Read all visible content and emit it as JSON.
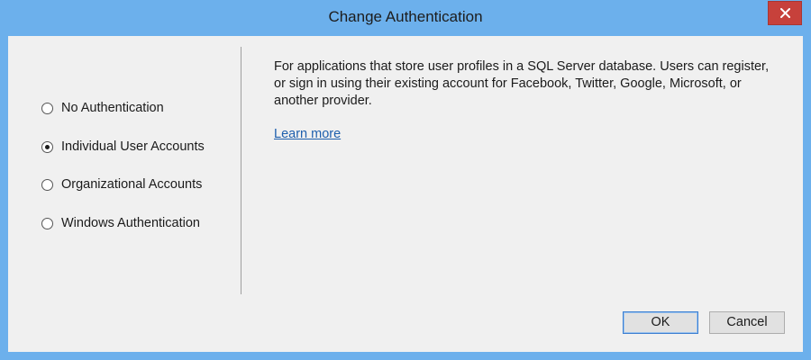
{
  "window": {
    "title": "Change Authentication"
  },
  "auth_options": [
    {
      "label": "No Authentication",
      "checked": false
    },
    {
      "label": "Individual User Accounts",
      "checked": true
    },
    {
      "label": "Organizational Accounts",
      "checked": false
    },
    {
      "label": "Windows Authentication",
      "checked": false
    }
  ],
  "description": {
    "text": "For applications that store user profiles in a SQL Server database. Users can register, or sign in using their existing account for Facebook, Twitter, Google, Microsoft, or another provider.",
    "learn_more": "Learn more"
  },
  "buttons": {
    "ok": "OK",
    "cancel": "Cancel"
  },
  "colors": {
    "frame": "#6cb0ec",
    "close": "#c7413b",
    "link": "#1e5fad"
  }
}
